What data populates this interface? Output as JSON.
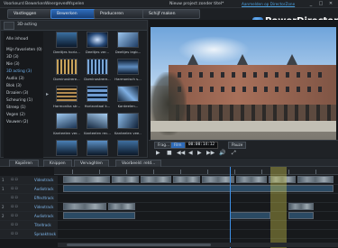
{
  "menubar": {
    "items": [
      "Voorkeurd",
      "Bewerken",
      "Weergeven",
      "Afspelen"
    ],
    "project_title": "Nieuw project zonder titel*",
    "upgrade_link": "Aanmelden op DirectorZone",
    "window_buttons": [
      "_",
      "□",
      "✕"
    ]
  },
  "tabs": [
    "Vastleggen",
    "Bewerken",
    "Produceren",
    "Schijf maken"
  ],
  "logo": "PowerDirector",
  "library": {
    "filter_label": "3D-acting",
    "categories": [
      "Alle inhoud",
      "Mijn favorieten (0)",
      "3D (3)",
      "Nie (3)",
      "3D acting (3)",
      "Audio (3)",
      "Blok (3)",
      "Draaien (3)",
      "Scheuring (1)",
      "Streep (1)",
      "Vegen (2)",
      "Vouwen (2)"
    ],
    "thumbs": [
      {
        "label": "Deeltjes horiz..."
      },
      {
        "label": "Deeltjes ver..."
      },
      {
        "label": "Deeltjes legb..."
      },
      {
        "label": "Dominostrere..."
      },
      {
        "label": "Dominostrere..."
      },
      {
        "label": "Harmonisch s..."
      },
      {
        "label": "Harmonika str..."
      },
      {
        "label": "Horizontaal k..."
      },
      {
        "label": "Kanteelen..."
      },
      {
        "label": "Kanteelen ver..."
      },
      {
        "label": "Kanteelen rec..."
      },
      {
        "label": "Kanteelen vee..."
      }
    ]
  },
  "playback": {
    "mode_buttons": [
      "Frag...",
      "Film"
    ],
    "timecode": "00:00:14:12",
    "pause_label": "Pauze",
    "controls": [
      "▶",
      "■",
      "◀◀",
      "◀",
      "▶",
      "▶▶",
      "🔊",
      "⤢"
    ]
  },
  "edit_tabs": [
    "Kopiëren",
    "Knippen",
    "Vervaghten",
    "Voorbeeld: retd..."
  ],
  "timeline": {
    "tracks": [
      {
        "num": "1",
        "name": "Videotrack",
        "kind": "video"
      },
      {
        "num": "1",
        "name": "Audiotrack",
        "kind": "audio"
      },
      {
        "num": "",
        "name": "Effecttrack",
        "kind": "effect"
      },
      {
        "num": "2",
        "name": "Videotrack",
        "kind": "video"
      },
      {
        "num": "2",
        "name": "Audiotrack",
        "kind": "audio"
      },
      {
        "num": "",
        "name": "Titeltrack",
        "kind": "title"
      },
      {
        "num": "",
        "name": "Spraaktrack",
        "kind": "voice"
      }
    ]
  },
  "colors": {
    "accent": "#2d6ab8",
    "track_label": "#7fb8ee",
    "playhead": "#3d8fe6",
    "highlight_band": "#e6dc50"
  }
}
